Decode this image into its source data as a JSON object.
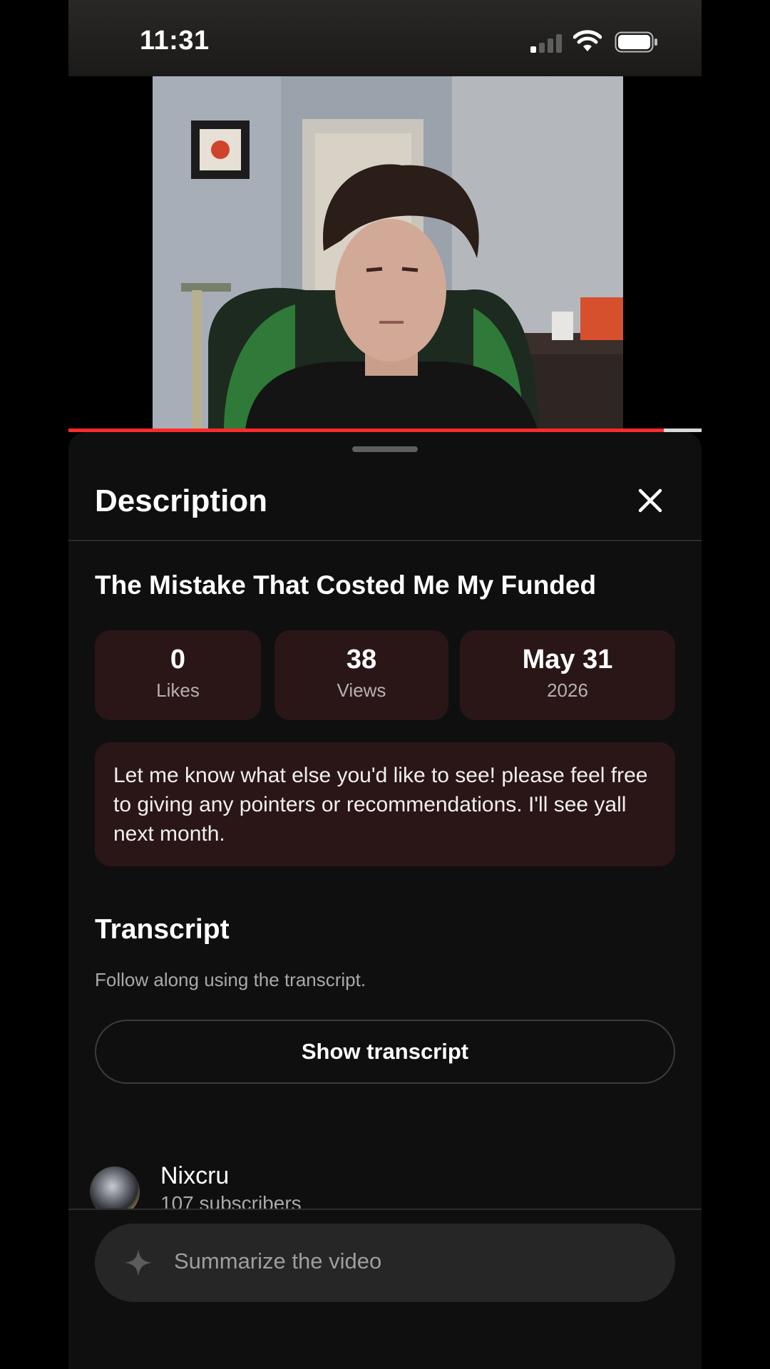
{
  "status_bar": {
    "time": "11:31"
  },
  "video": {
    "progress": 0.94
  },
  "sheet": {
    "title": "Description",
    "video_title": "The Mistake That Costed Me My Funded",
    "stats": {
      "likes_value": "0",
      "likes_label": "Likes",
      "views_value": "38",
      "views_label": "Views",
      "date_value": "May 31",
      "date_label": "2026"
    },
    "description": "Let me know what else you'd like to see! please feel free to giving any pointers or recommendations. I'll see yall next month.",
    "transcript": {
      "title": "Transcript",
      "hint": "Follow along using the transcript.",
      "button_label": "Show transcript"
    },
    "channel": {
      "name": "Nixcru",
      "subscribers": "107 subscribers"
    },
    "summarize": {
      "placeholder": "Summarize the video"
    }
  },
  "colors": {
    "accent_card": "#2a1617",
    "sheet_bg": "#0f0f0f",
    "progress": "#ff2a2a"
  },
  "icons": [
    "signal-icon",
    "wifi-icon",
    "battery-icon",
    "close-icon",
    "sparkle-icon"
  ]
}
